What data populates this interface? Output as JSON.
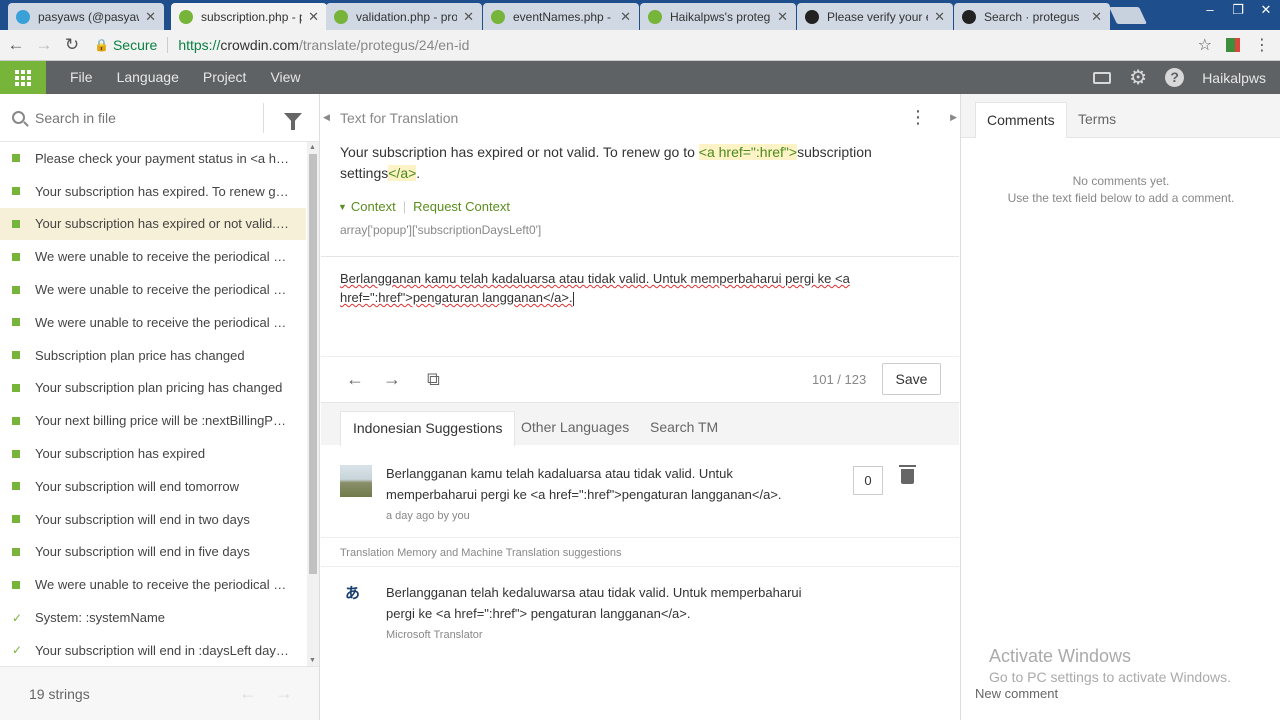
{
  "browser": {
    "tabs": [
      {
        "title": "pasyaws (@pasyaws",
        "fav": "#3aa0d8"
      },
      {
        "title": "subscription.php - p",
        "fav": "#76b43a"
      },
      {
        "title": "validation.php - pro",
        "fav": "#76b43a"
      },
      {
        "title": "eventNames.php - p",
        "fav": "#76b43a"
      },
      {
        "title": "Haikalpws's proteg",
        "fav": "#76b43a"
      },
      {
        "title": "Please verify your e",
        "fav": "#222222"
      },
      {
        "title": "Search · protegus",
        "fav": "#222222"
      }
    ],
    "close_glyph": "✕",
    "secure_label": "Secure",
    "url_proto": "https://",
    "url_host": "crowdin.com",
    "url_path": "/translate/protegus/24/en-id"
  },
  "menubar": {
    "items": [
      "File",
      "Language",
      "Project",
      "View"
    ],
    "username": "Haikalpws"
  },
  "left": {
    "search_placeholder": "Search in file",
    "strings": [
      {
        "text": "Please check your payment status in <a hre...",
        "status": "dot"
      },
      {
        "text": "Your subscription has expired. To renew go...",
        "status": "dot"
      },
      {
        "text": "Your subscription has expired or not valid. ...",
        "status": "dot",
        "selected": true
      },
      {
        "text": "We were unable to receive the periodical p...",
        "status": "dot"
      },
      {
        "text": "We were unable to receive the periodical p...",
        "status": "dot"
      },
      {
        "text": "We were unable to receive the periodical p...",
        "status": "dot"
      },
      {
        "text": "Subscription plan price has changed",
        "status": "dot"
      },
      {
        "text": "Your subscription plan pricing has changed",
        "status": "dot"
      },
      {
        "text": "Your next billing price will be :nextBillingPri...",
        "status": "dot"
      },
      {
        "text": "Your subscription has expired",
        "status": "dot"
      },
      {
        "text": "Your subscription will end tomorrow",
        "status": "dot"
      },
      {
        "text": "Your subscription will end in two days",
        "status": "dot"
      },
      {
        "text": "Your subscription will end in five days",
        "status": "dot"
      },
      {
        "text": "We were unable to receive the periodical p...",
        "status": "dot"
      },
      {
        "text": "System: :systemName",
        "status": "check"
      },
      {
        "text": "Your subscription will end in :daysLeft days,...",
        "status": "check"
      }
    ],
    "footer_count": "19 strings"
  },
  "source": {
    "header": "Text for Translation",
    "text_before": "Your subscription has expired or not valid. To renew go to ",
    "tag_open": "<a href=\":href\">",
    "text_middle": "subscription settings",
    "tag_close": "</a>",
    "text_after": ".",
    "context_label": "Context",
    "request_context_label": "Request Context",
    "context_key": "array['popup']['subscriptionDaysLeft0']"
  },
  "translation": {
    "text": "Berlangganan kamu telah kadaluarsa atau tidak valid. Untuk memperbaharui pergi ke <a href=\":href\">pengaturan langganan</a>."
  },
  "toolbar": {
    "counter": "101 / 123",
    "save_label": "Save"
  },
  "suggestions": {
    "tabs": [
      "Indonesian Suggestions",
      "Other Languages",
      "Search TM"
    ],
    "own": {
      "text": "Berlangganan kamu telah kadaluarsa atau tidak valid. Untuk memperbaharui pergi ke <a href=\":href\">pengaturan langganan</a>.",
      "meta": "a day ago by you",
      "votes": "0"
    },
    "tm_header": "Translation Memory and Machine Translation suggestions",
    "mt": {
      "text": "Berlangganan telah kedaluwarsa atau tidak valid. Untuk memperbaharui pergi ke <a href=\":href\"> pengaturan langganan</a>.",
      "source": "Microsoft Translator"
    }
  },
  "comments": {
    "tabs": [
      "Comments",
      "Terms"
    ],
    "empty_line1": "No comments yet.",
    "empty_line2": "Use the text field below to add a comment.",
    "new_comment_label": "New comment"
  },
  "watermark": {
    "line1": "Activate Windows",
    "line2": "Go to PC settings to activate Windows."
  }
}
